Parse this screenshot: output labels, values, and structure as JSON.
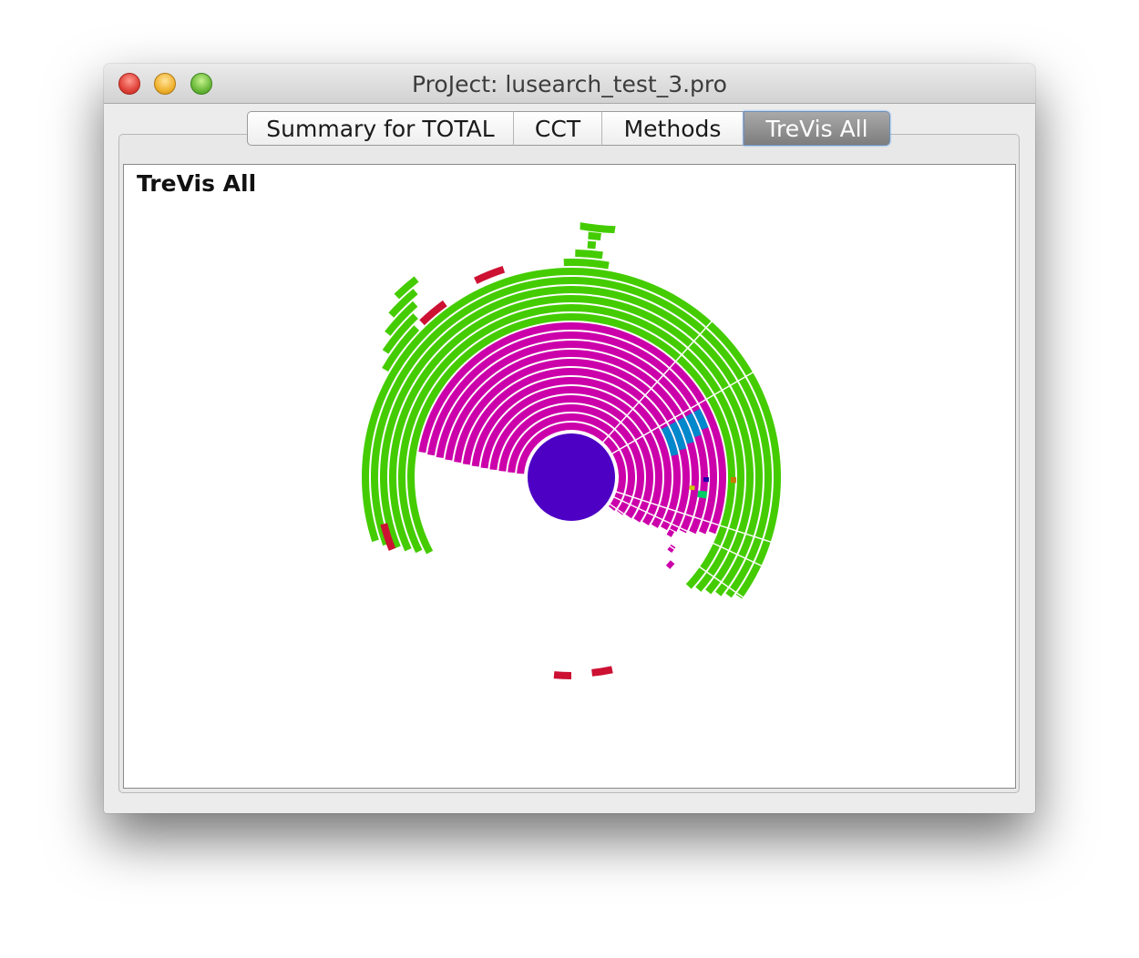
{
  "window": {
    "title": "ProJect: lusearch_test_3.pro"
  },
  "tabs": [
    {
      "label": "Summary for TOTAL",
      "active": false
    },
    {
      "label": "CCT",
      "active": false
    },
    {
      "label": "Methods",
      "active": false
    },
    {
      "label": "TreVis All",
      "active": true
    }
  ],
  "panel": {
    "title": "TreVis All"
  },
  "colors": {
    "root": "#4d00c4",
    "magenta": "#cc00aa",
    "green": "#44cc00",
    "red": "#cc1133",
    "blue": "#0088cc",
    "orange": "#cc7700",
    "navy": "#2200aa",
    "yellow": "#cccc00",
    "teal": "#00cc66"
  }
}
